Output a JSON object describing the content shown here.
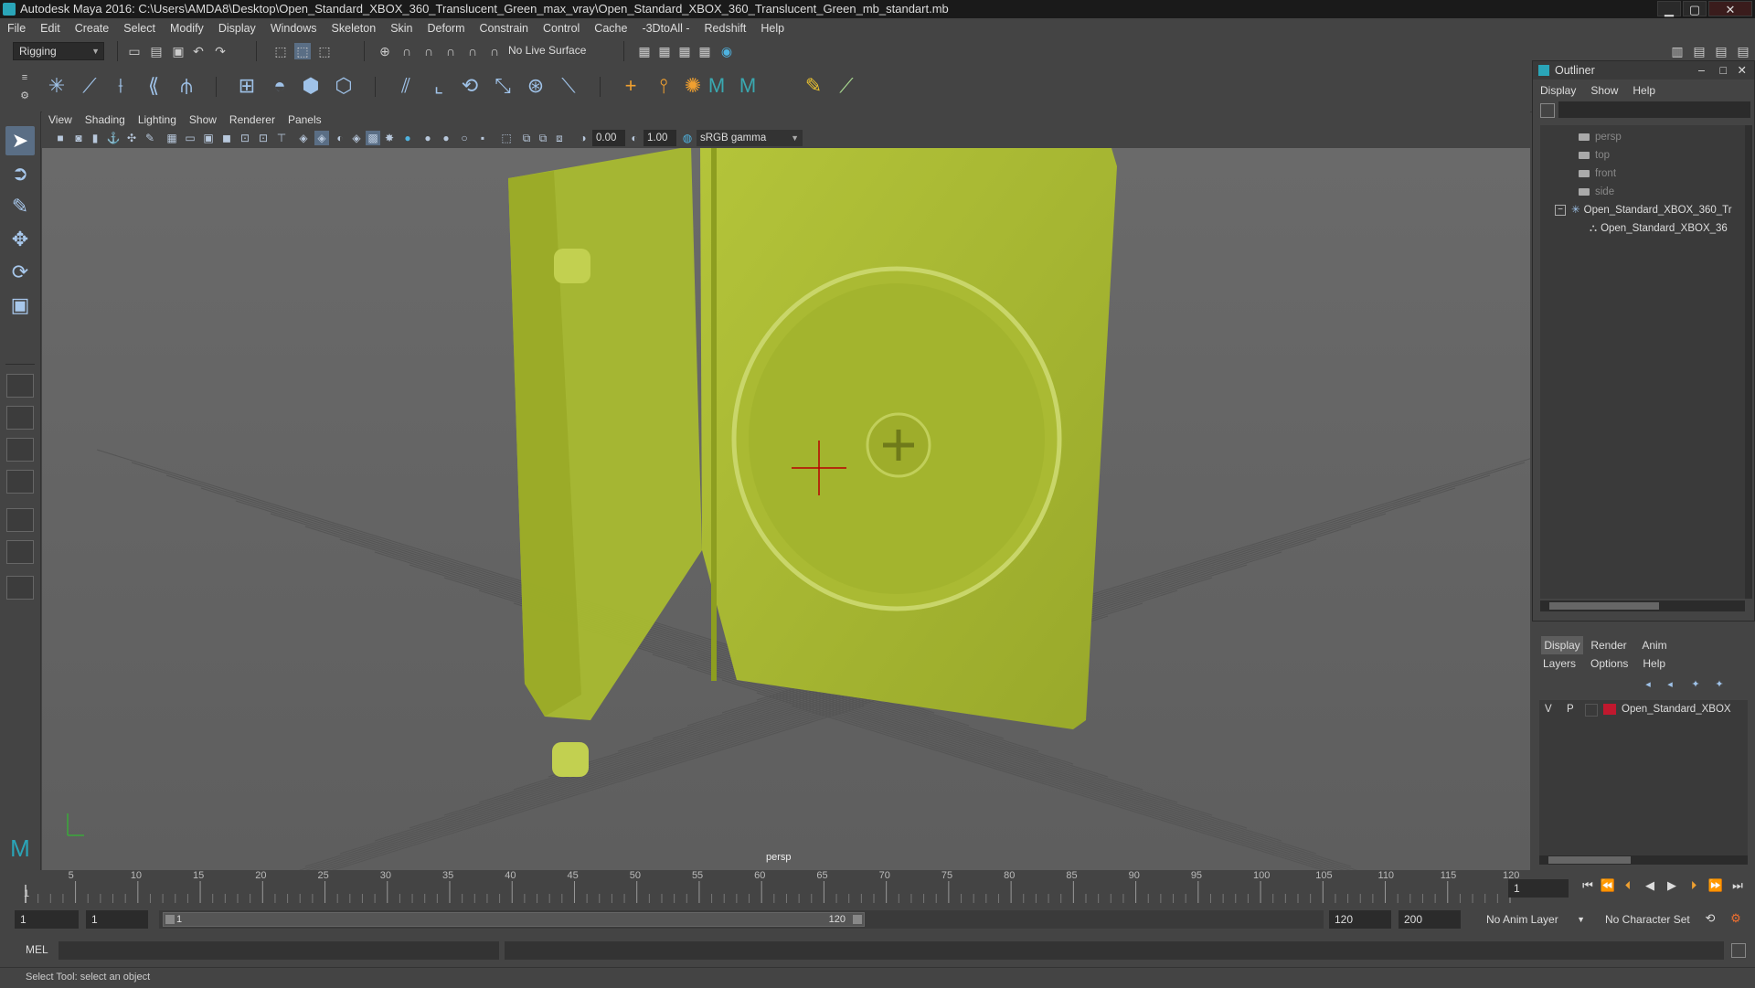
{
  "window": {
    "title": "Autodesk Maya 2016: C:\\Users\\AMDA8\\Desktop\\Open_Standard_XBOX_360_Translucent_Green_max_vray\\Open_Standard_XBOX_360_Translucent_Green_mb_standart.mb",
    "minimize": "▁",
    "maximize": "▢",
    "close": "✕"
  },
  "menubar": [
    "File",
    "Edit",
    "Create",
    "Select",
    "Modify",
    "Display",
    "Windows",
    "Skeleton",
    "Skin",
    "Deform",
    "Constrain",
    "Control",
    "Cache",
    "-3DtoAll -",
    "Redshift",
    "Help"
  ],
  "statusline": {
    "mode": "Rigging",
    "live_surface": "No Live Surface"
  },
  "panel": {
    "menus": [
      "View",
      "Shading",
      "Lighting",
      "Show",
      "Renderer",
      "Panels"
    ],
    "near_value": "0.00",
    "far_value": "1.00",
    "colorspace": "sRGB gamma",
    "camera_label": "persp"
  },
  "outliner": {
    "title": "Outliner",
    "menus": [
      "Display",
      "Show",
      "Help"
    ],
    "items": [
      {
        "label": "persp",
        "kind": "camera"
      },
      {
        "label": "top",
        "kind": "camera"
      },
      {
        "label": "front",
        "kind": "camera"
      },
      {
        "label": "side",
        "kind": "camera"
      },
      {
        "label": "Open_Standard_XBOX_360_Tr",
        "kind": "group"
      },
      {
        "label": "Open_Standard_XBOX_36",
        "kind": "mesh"
      }
    ]
  },
  "layer_editor": {
    "tabs": [
      "Display",
      "Render",
      "Anim"
    ],
    "active_tab": "Display",
    "menus": [
      "Layers",
      "Options",
      "Help"
    ],
    "layer": {
      "v": "V",
      "p": "P",
      "name": "Open_Standard_XBOX",
      "color": "#c0182e"
    }
  },
  "timeline": {
    "ticks": [
      "5",
      "10",
      "15",
      "20",
      "25",
      "30",
      "35",
      "40",
      "45",
      "50",
      "55",
      "60",
      "65",
      "70",
      "75",
      "80",
      "85",
      "90",
      "95",
      "100",
      "105",
      "110",
      "115",
      "120"
    ],
    "tick_first": "1",
    "current_frame": "1",
    "range_start": "1",
    "range_inner_start": "1",
    "range_thumb_start": "1",
    "range_thumb_end": "120",
    "range_end": "120",
    "range_max": "200",
    "anim_layer": "No Anim Layer",
    "character_set": "No Character Set"
  },
  "commandline": {
    "label": "MEL"
  },
  "helpline": {
    "text": "Select Tool: select an object"
  },
  "colors": {
    "case_green": "#a8b830",
    "accent": "#5a6e85",
    "layer_red": "#c0182e"
  }
}
